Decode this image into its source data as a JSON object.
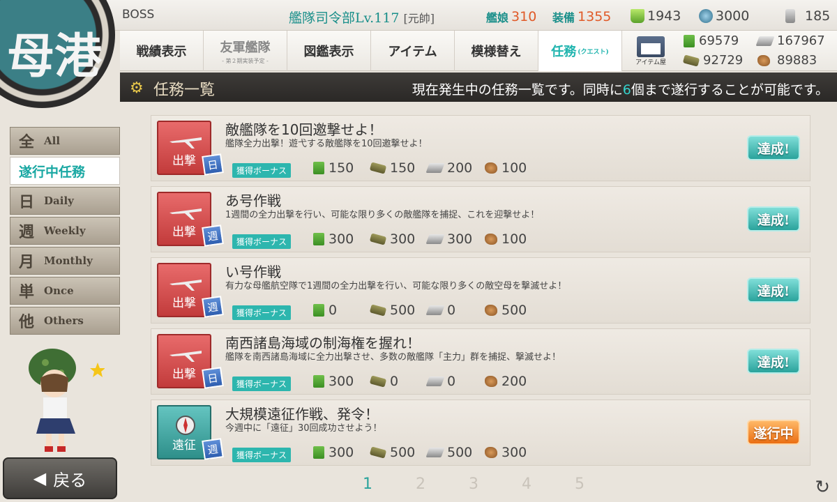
{
  "header": {
    "owner": "BOSS",
    "hq_level": "艦隊司令部Lv.117",
    "rank": "[元帥]",
    "ships_label": "艦娘",
    "ships_value": "310",
    "equip_label": "装備",
    "equip_value": "1355",
    "buckets": "1943",
    "dev_materials": "3000",
    "screws": "185"
  },
  "nav": {
    "items": [
      "戦績表示",
      "友軍艦隊",
      "図鑑表示",
      "アイテム",
      "模様替え"
    ],
    "friend_fleet_sub": "- 第２期実装予定 -",
    "quest_label": "任務",
    "quest_sub": "(クエスト)",
    "shop_label": "アイテム屋"
  },
  "materials": {
    "fuel": "69579",
    "steel": "167967",
    "ammo": "92729",
    "bauxite": "89883"
  },
  "title": {
    "label": "任務一覧",
    "message_pre": "現在発生中の任務一覧です。同時に",
    "message_num": "6",
    "message_post": "個まで遂行することが可能です。"
  },
  "logo_text": "母港",
  "sidebar": {
    "all_big": "全",
    "all_en": "All",
    "active": "遂行中任務",
    "daily_big": "日",
    "daily_en": "Daily",
    "weekly_big": "週",
    "weekly_en": "Weekly",
    "monthly_big": "月",
    "monthly_en": "Monthly",
    "once_big": "単",
    "once_en": "Once",
    "others_big": "他",
    "others_en": "Others"
  },
  "back_label": "戻る",
  "bonus_label": "獲得ボーナス",
  "quests": [
    {
      "category": "出撃",
      "type": "日",
      "title": "敵艦隊を10回邀撃せよ！",
      "desc": "艦隊全力出撃！遊弋する敵艦隊を10回邀撃せよ！",
      "fuel": "150",
      "ammo": "150",
      "steel": "200",
      "baux": "100",
      "status": "達成!"
    },
    {
      "category": "出撃",
      "type": "週",
      "title": "あ号作戦",
      "desc": "1週間の全力出撃を行い、可能な限り多くの敵艦隊を捕捉、これを迎撃せよ！",
      "fuel": "300",
      "ammo": "300",
      "steel": "300",
      "baux": "100",
      "status": "達成!"
    },
    {
      "category": "出撃",
      "type": "週",
      "title": "い号作戦",
      "desc": "有力な母艦航空隊で1週間の全力出撃を行い、可能な限り多くの敵空母を撃滅せよ！",
      "fuel": "0",
      "ammo": "500",
      "steel": "0",
      "baux": "500",
      "status": "達成!"
    },
    {
      "category": "出撃",
      "type": "日",
      "title": "南西諸島海域の制海権を握れ！",
      "desc": "艦隊を南西諸島海域に全力出撃させ、多数の敵艦隊「主力」群を捕捉、撃滅せよ！",
      "fuel": "300",
      "ammo": "0",
      "steel": "0",
      "baux": "200",
      "status": "達成!"
    },
    {
      "category": "遠征",
      "type": "週",
      "title": "大規模遠征作戦、発令！",
      "desc": "今週中に「遠征」30回成功させよう！",
      "fuel": "300",
      "ammo": "500",
      "steel": "500",
      "baux": "300",
      "status": "遂行中"
    }
  ],
  "pager": [
    "1",
    "2",
    "3",
    "4",
    "5"
  ]
}
